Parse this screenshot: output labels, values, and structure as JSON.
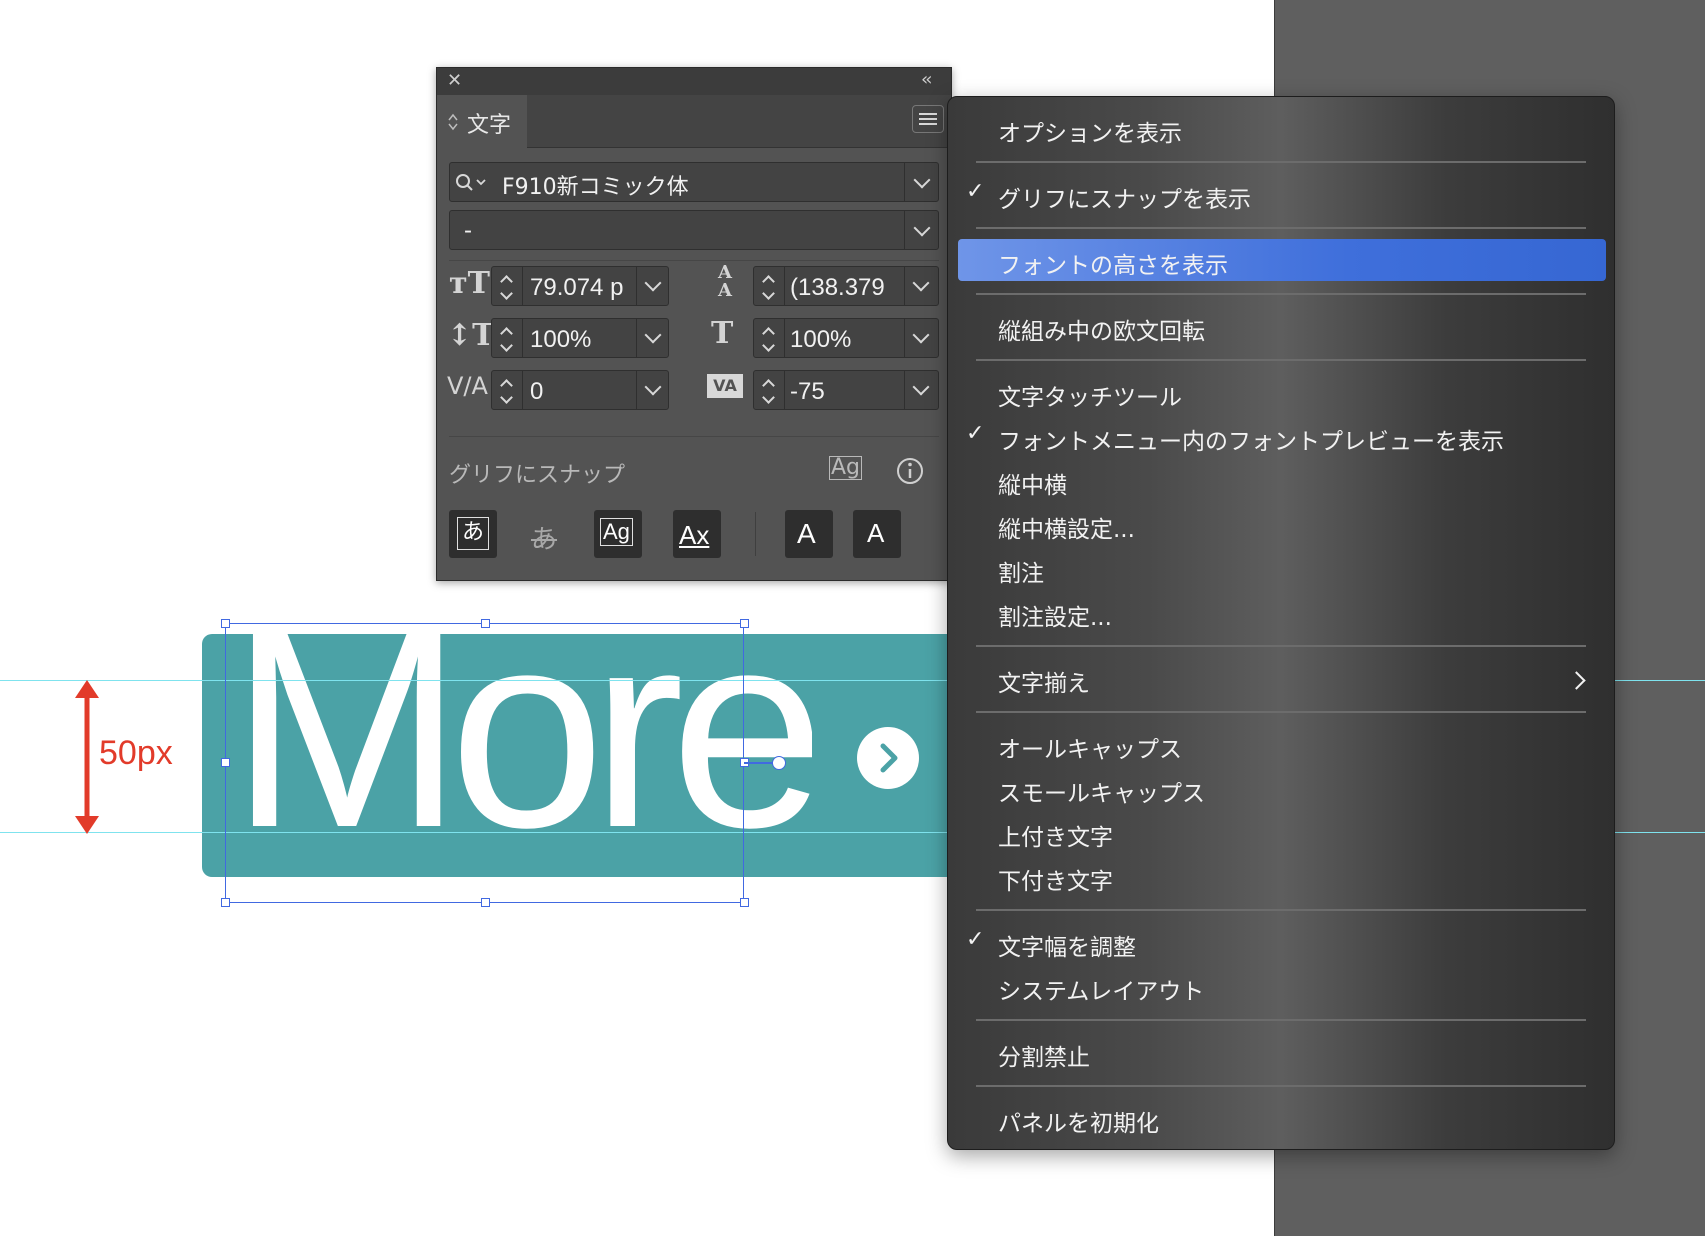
{
  "canvas": {
    "button_text": "More",
    "dimension_label": "50px",
    "arrow_icon": "chevron-right-icon"
  },
  "panel": {
    "close_icon": "✕",
    "collapse_icon": "‹‹",
    "tab_label": "文字",
    "font_family": "F910新コミック体",
    "font_style": "-",
    "font_size": "79.074 p",
    "leading": "(138.379",
    "vertical_scale": "100%",
    "horizontal_scale": "100%",
    "kerning": "0",
    "tracking": "-75",
    "snap_label": "グリフにスナップ",
    "buttons": {
      "b1": "あ",
      "b2": "あ",
      "b3": "Ag",
      "b4": "Ax",
      "b5": "A",
      "b6": "A"
    }
  },
  "menu": {
    "items": {
      "show_options": "オプションを表示",
      "snap_to_glyph": "グリフにスナップを表示",
      "show_font_height": "フォントの高さを表示",
      "rotate_roman": "縦組み中の欧文回転",
      "touch_tool": "文字タッチツール",
      "font_preview": "フォントメニュー内のフォントプレビューを表示",
      "tate_chu_yoko": "縦中横",
      "tate_chu_yoko_settings": "縦中横設定...",
      "warichu": "割注",
      "warichu_settings": "割注設定...",
      "align": "文字揃え",
      "all_caps": "オールキャップス",
      "small_caps": "スモールキャップス",
      "superscript": "上付き文字",
      "subscript": "下付き文字",
      "adjust_width": "文字幅を調整",
      "system_layout": "システムレイアウト",
      "no_break": "分割禁止",
      "reset_panel": "パネルを初期化"
    },
    "check_mark": "✓"
  },
  "colors": {
    "teal": "#4ba2a6",
    "highlight": "#3f6fdb",
    "selection": "#4169e1",
    "dimension": "#e23b2a",
    "guide": "#7fe3ee"
  }
}
